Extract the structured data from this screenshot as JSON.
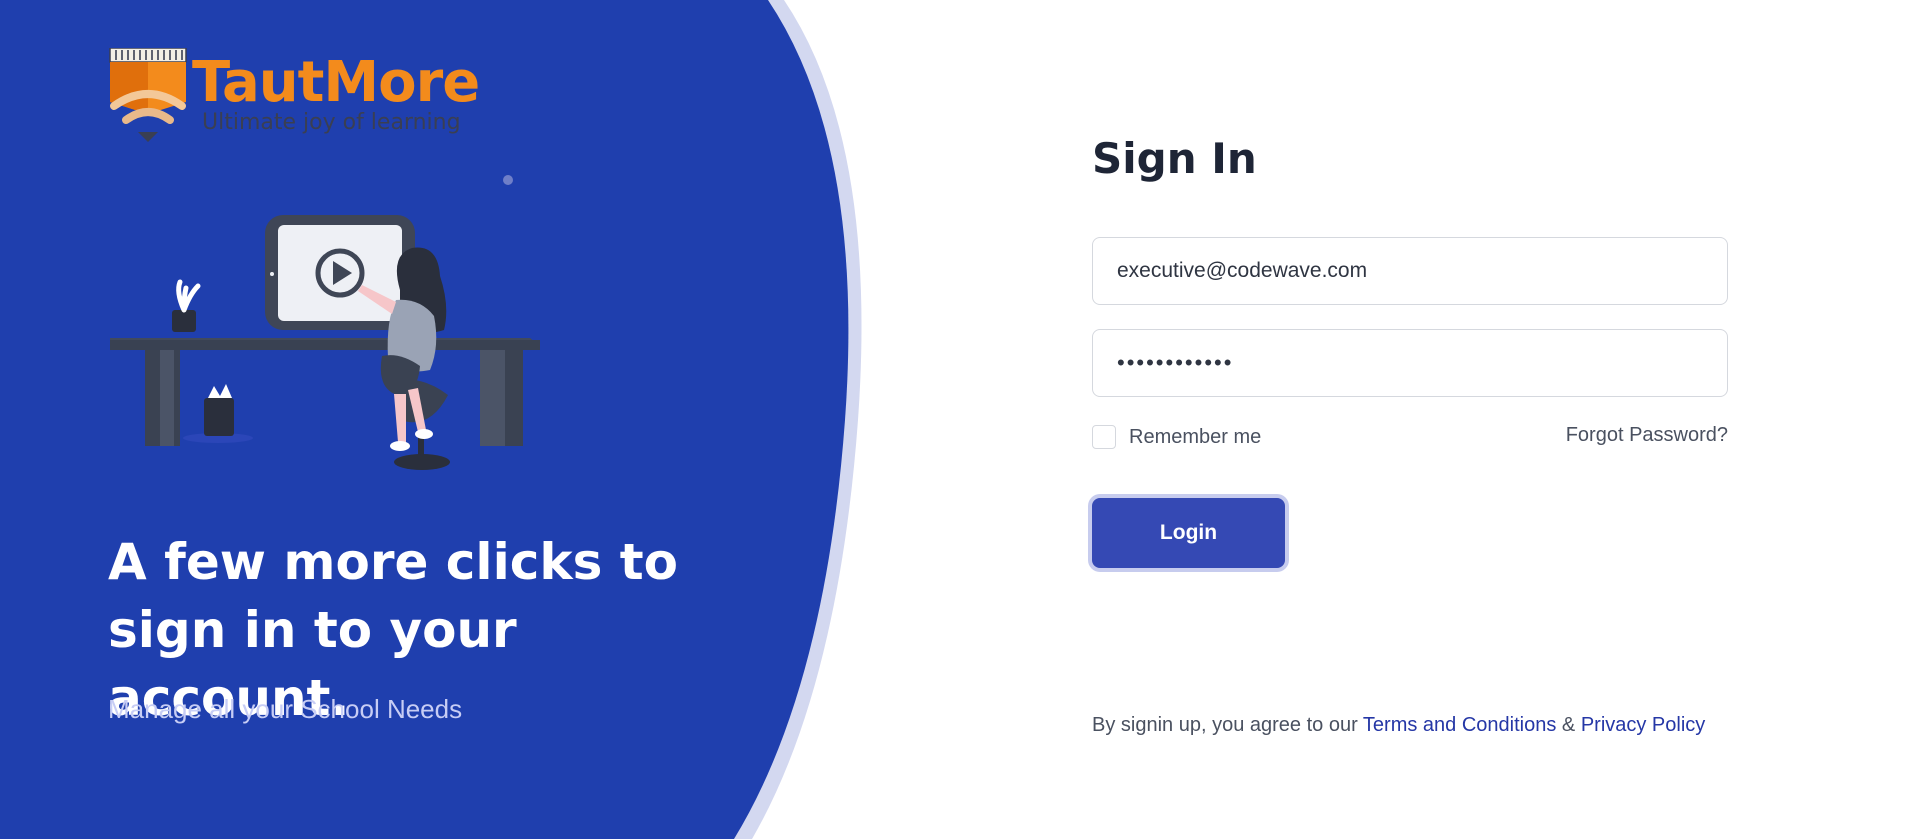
{
  "brand": {
    "name": "TautMore",
    "tagline": "Ultimate joy of learning"
  },
  "hero": {
    "headline": "A few more clicks to sign in to your account.",
    "subline": "Manage all your School Needs"
  },
  "form": {
    "title": "Sign In",
    "email_value": "executive@codewave.com",
    "password_value": "••••••••••••",
    "remember_label": "Remember me",
    "remember_checked": false,
    "forgot_label": "Forgot Password?",
    "login_label": "Login"
  },
  "footer": {
    "prefix": "By signin up, you agree to our ",
    "terms_label": "Terms and Conditions",
    "amp": " & ",
    "privacy_label": "Privacy Policy"
  },
  "colors": {
    "panel_blue": "#1f3fae",
    "panel_edge": "#d3d8f0",
    "brand_orange": "#f38b1c",
    "button_blue": "#3549b4",
    "link_blue": "#2537a6"
  },
  "icons": {
    "logo": "tautmore-logo-icon",
    "illustration": "video-lesson-illustration"
  }
}
